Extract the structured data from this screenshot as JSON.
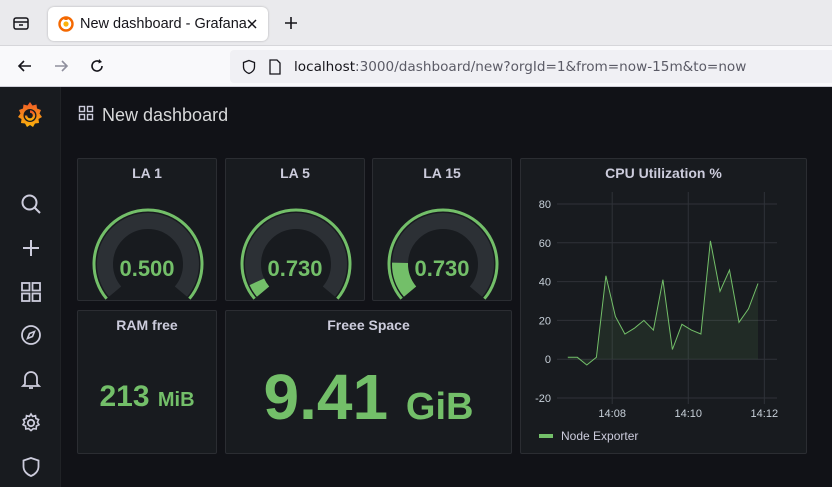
{
  "browser": {
    "tab_title": "New dashboard - Grafana",
    "url_host": "localhost",
    "url_rest": ":3000/dashboard/new?orgId=1&from=now-15m&to=now"
  },
  "dashboard": {
    "title": "New dashboard"
  },
  "sidebar": {
    "items": [
      "grafana-logo-icon",
      "search-icon",
      "plus-icon",
      "dashboards-icon",
      "explore-icon",
      "alerting-bell-icon",
      "gear-icon",
      "shield-icon"
    ]
  },
  "panels": {
    "la1": {
      "title": "LA 1",
      "value": "0.500",
      "fraction": 0.0
    },
    "la5": {
      "title": "LA 5",
      "value": "0.730",
      "fraction": 0.06
    },
    "la15": {
      "title": "LA 15",
      "value": "0.730",
      "fraction": 0.16
    },
    "ram": {
      "title": "RAM free",
      "value": "213",
      "unit": "MiB"
    },
    "space": {
      "title": "Freee Space",
      "value": "9.41",
      "unit": "GiB"
    },
    "cpu": {
      "title": "CPU Utilization %",
      "legend": "Node Exporter"
    }
  },
  "colors": {
    "accent_green": "#73bf69",
    "panel_bg": "#181b1f",
    "page_bg": "#111217"
  },
  "chart_data": {
    "type": "area",
    "title": "CPU Utilization %",
    "xlabel": "",
    "ylabel": "",
    "ylim": [
      -20,
      80
    ],
    "yticks": [
      "80",
      "60",
      "40",
      "20",
      "0",
      "-20"
    ],
    "xticks": [
      "14:08",
      "14:10",
      "14:12"
    ],
    "grid": true,
    "legend_placement": "bottom-left",
    "series": [
      {
        "name": "Node Exporter",
        "color": "#73bf69",
        "x": [
          "14:06:50",
          "14:07:05",
          "14:07:20",
          "14:07:35",
          "14:07:50",
          "14:08:05",
          "14:08:20",
          "14:08:35",
          "14:08:50",
          "14:09:05",
          "14:09:20",
          "14:09:35",
          "14:09:50",
          "14:10:05",
          "14:10:20",
          "14:10:35",
          "14:10:50",
          "14:11:05",
          "14:11:20",
          "14:11:35",
          "14:11:50",
          "14:12:05",
          "14:12:20"
        ],
        "values": [
          1,
          1,
          -3,
          1,
          43,
          22,
          13,
          16,
          20,
          15,
          41,
          5,
          18,
          15,
          13,
          61,
          35,
          46,
          19,
          26,
          39,
          null,
          null
        ]
      }
    ]
  }
}
